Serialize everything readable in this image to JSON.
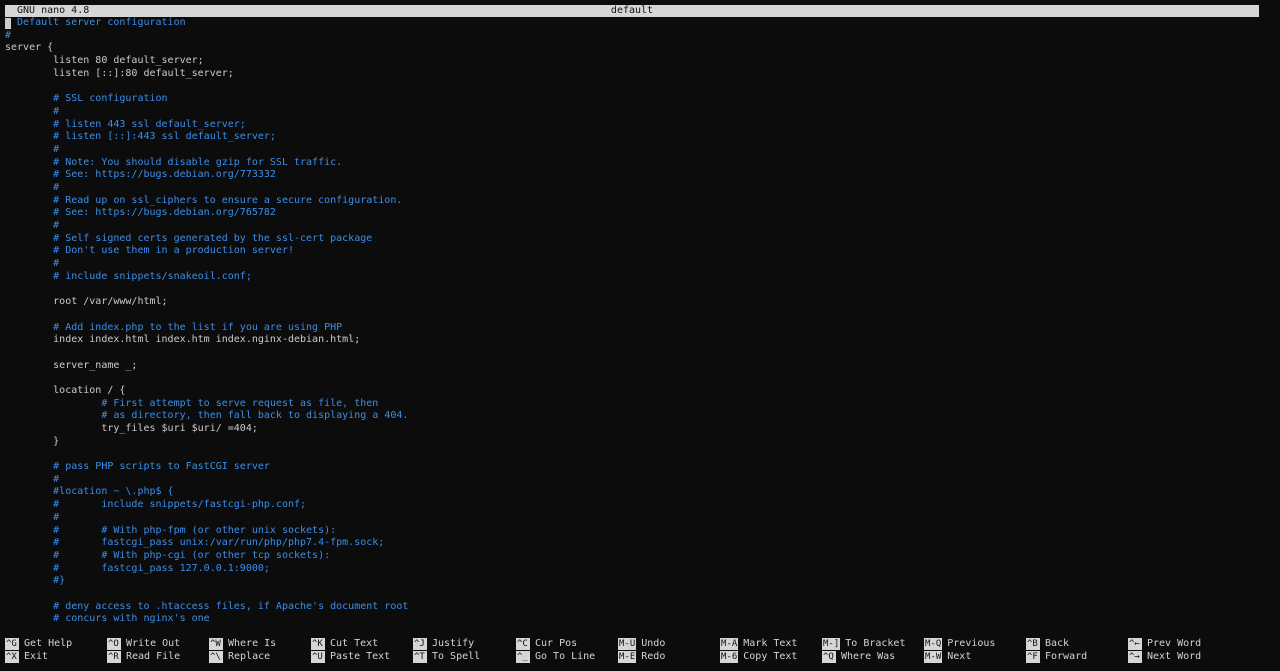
{
  "titlebar": {
    "app": "GNU nano 4.8",
    "filename": "default"
  },
  "editor": {
    "lines": [
      {
        "text": "# Default server configuration",
        "kind": "comment"
      },
      {
        "text": "#",
        "kind": "comment"
      },
      {
        "text": "server {",
        "kind": "code"
      },
      {
        "text": "        listen 80 default_server;",
        "kind": "code"
      },
      {
        "text": "        listen [::]:80 default_server;",
        "kind": "code"
      },
      {
        "text": "",
        "kind": "code"
      },
      {
        "text": "        # SSL configuration",
        "kind": "comment"
      },
      {
        "text": "        #",
        "kind": "comment"
      },
      {
        "text": "        # listen 443 ssl default_server;",
        "kind": "comment"
      },
      {
        "text": "        # listen [::]:443 ssl default_server;",
        "kind": "comment"
      },
      {
        "text": "        #",
        "kind": "comment"
      },
      {
        "text": "        # Note: You should disable gzip for SSL traffic.",
        "kind": "comment"
      },
      {
        "text": "        # See: https://bugs.debian.org/773332",
        "kind": "comment"
      },
      {
        "text": "        #",
        "kind": "comment"
      },
      {
        "text": "        # Read up on ssl_ciphers to ensure a secure configuration.",
        "kind": "comment"
      },
      {
        "text": "        # See: https://bugs.debian.org/765782",
        "kind": "comment"
      },
      {
        "text": "        #",
        "kind": "comment"
      },
      {
        "text": "        # Self signed certs generated by the ssl-cert package",
        "kind": "comment"
      },
      {
        "text": "        # Don't use them in a production server!",
        "kind": "comment"
      },
      {
        "text": "        #",
        "kind": "comment"
      },
      {
        "text": "        # include snippets/snakeoil.conf;",
        "kind": "comment"
      },
      {
        "text": "",
        "kind": "code"
      },
      {
        "text": "        root /var/www/html;",
        "kind": "code"
      },
      {
        "text": "",
        "kind": "code"
      },
      {
        "text": "        # Add index.php to the list if you are using PHP",
        "kind": "comment"
      },
      {
        "text": "        index index.html index.htm index.nginx-debian.html;",
        "kind": "code"
      },
      {
        "text": "",
        "kind": "code"
      },
      {
        "text": "        server_name _;",
        "kind": "code"
      },
      {
        "text": "",
        "kind": "code"
      },
      {
        "text": "        location / {",
        "kind": "code"
      },
      {
        "text": "                # First attempt to serve request as file, then",
        "kind": "comment"
      },
      {
        "text": "                # as directory, then fall back to displaying a 404.",
        "kind": "comment"
      },
      {
        "text": "                try_files $uri $uri/ =404;",
        "kind": "code"
      },
      {
        "text": "        }",
        "kind": "code"
      },
      {
        "text": "",
        "kind": "code"
      },
      {
        "text": "        # pass PHP scripts to FastCGI server",
        "kind": "comment"
      },
      {
        "text": "        #",
        "kind": "comment"
      },
      {
        "text": "        #location ~ \\.php$ {",
        "kind": "comment"
      },
      {
        "text": "        #       include snippets/fastcgi-php.conf;",
        "kind": "comment"
      },
      {
        "text": "        #",
        "kind": "comment"
      },
      {
        "text": "        #       # With php-fpm (or other unix sockets):",
        "kind": "comment"
      },
      {
        "text": "        #       fastcgi_pass unix:/var/run/php/php7.4-fpm.sock;",
        "kind": "comment"
      },
      {
        "text": "        #       # With php-cgi (or other tcp sockets):",
        "kind": "comment"
      },
      {
        "text": "        #       fastcgi_pass 127.0.0.1:9000;",
        "kind": "comment"
      },
      {
        "text": "        #}",
        "kind": "comment"
      },
      {
        "text": "",
        "kind": "code"
      },
      {
        "text": "        # deny access to .htaccess files, if Apache's document root",
        "kind": "comment"
      },
      {
        "text": "        # concurs with nginx's one",
        "kind": "comment"
      }
    ]
  },
  "shortcuts": [
    {
      "top": {
        "key": "^G",
        "label": "Get Help"
      },
      "bottom": {
        "key": "^X",
        "label": "Exit"
      }
    },
    {
      "top": {
        "key": "^O",
        "label": "Write Out"
      },
      "bottom": {
        "key": "^R",
        "label": "Read File"
      }
    },
    {
      "top": {
        "key": "^W",
        "label": "Where Is"
      },
      "bottom": {
        "key": "^\\",
        "label": "Replace"
      }
    },
    {
      "top": {
        "key": "^K",
        "label": "Cut Text"
      },
      "bottom": {
        "key": "^U",
        "label": "Paste Text"
      }
    },
    {
      "top": {
        "key": "^J",
        "label": "Justify"
      },
      "bottom": {
        "key": "^T",
        "label": "To Spell"
      }
    },
    {
      "top": {
        "key": "^C",
        "label": "Cur Pos"
      },
      "bottom": {
        "key": "^_",
        "label": "Go To Line"
      }
    },
    {
      "top": {
        "key": "M-U",
        "label": "Undo"
      },
      "bottom": {
        "key": "M-E",
        "label": "Redo"
      }
    },
    {
      "top": {
        "key": "M-A",
        "label": "Mark Text"
      },
      "bottom": {
        "key": "M-6",
        "label": "Copy Text"
      }
    },
    {
      "top": {
        "key": "M-]",
        "label": "To Bracket"
      },
      "bottom": {
        "key": "^Q",
        "label": "Where Was"
      }
    },
    {
      "top": {
        "key": "M-Q",
        "label": "Previous"
      },
      "bottom": {
        "key": "M-W",
        "label": "Next"
      }
    },
    {
      "top": {
        "key": "^B",
        "label": "Back"
      },
      "bottom": {
        "key": "^F",
        "label": "Forward"
      }
    },
    {
      "top": {
        "key": "^←",
        "label": "Prev Word"
      },
      "bottom": {
        "key": "^→",
        "label": "Next Word"
      }
    }
  ]
}
